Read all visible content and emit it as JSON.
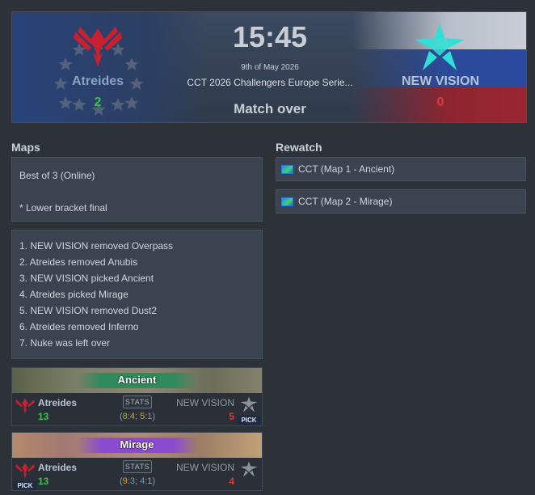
{
  "match": {
    "time": "15:45",
    "date": "9th of May 2026",
    "event": "CCT 2026 Challengers Europe Serie...",
    "status": "Match over",
    "team_left": {
      "name": "Atreides",
      "score": "2"
    },
    "team_right": {
      "name": "NEW VISION",
      "score": "0"
    }
  },
  "maps_section": {
    "title": "Maps",
    "format": "Best of 3 (Online)",
    "note": "* Lower bracket final",
    "veto": [
      "1. NEW VISION removed Overpass",
      "2. Atreides removed Anubis",
      "3. NEW VISION picked Ancient",
      "4. Atreides picked Mirage",
      "5. NEW VISION removed Dust2",
      "6. Atreides removed Inferno",
      "7. Nuke was left over"
    ]
  },
  "rewatch": {
    "title": "Rewatch",
    "items": [
      "CCT (Map 1 - Ancient)",
      "CCT (Map 2 - Mirage)"
    ]
  },
  "map_results": [
    {
      "map": "Ancient",
      "left_team": "Atreides",
      "left_score": "13",
      "right_team": "NEW VISION",
      "right_score": "5",
      "stats_label": "STATS",
      "halves": {
        "h1a": "8",
        "h1b": "4",
        "h2a": "5",
        "h2b": "1"
      },
      "pick_label": "PICK",
      "picked_by": "right"
    },
    {
      "map": "Mirage",
      "left_team": "Atreides",
      "left_score": "13",
      "right_team": "NEW VISION",
      "right_score": "4",
      "stats_label": "STATS",
      "halves": {
        "h1a": "9",
        "h1b": "3",
        "h2a": "4",
        "h2b": "1"
      },
      "pick_label": "PICK",
      "picked_by": "left"
    }
  ],
  "colors": {
    "win": "#38c24a",
    "loss": "#e23a3a",
    "left_team_logo": "#c8202e",
    "right_team_logo": "#2fe0d6"
  }
}
